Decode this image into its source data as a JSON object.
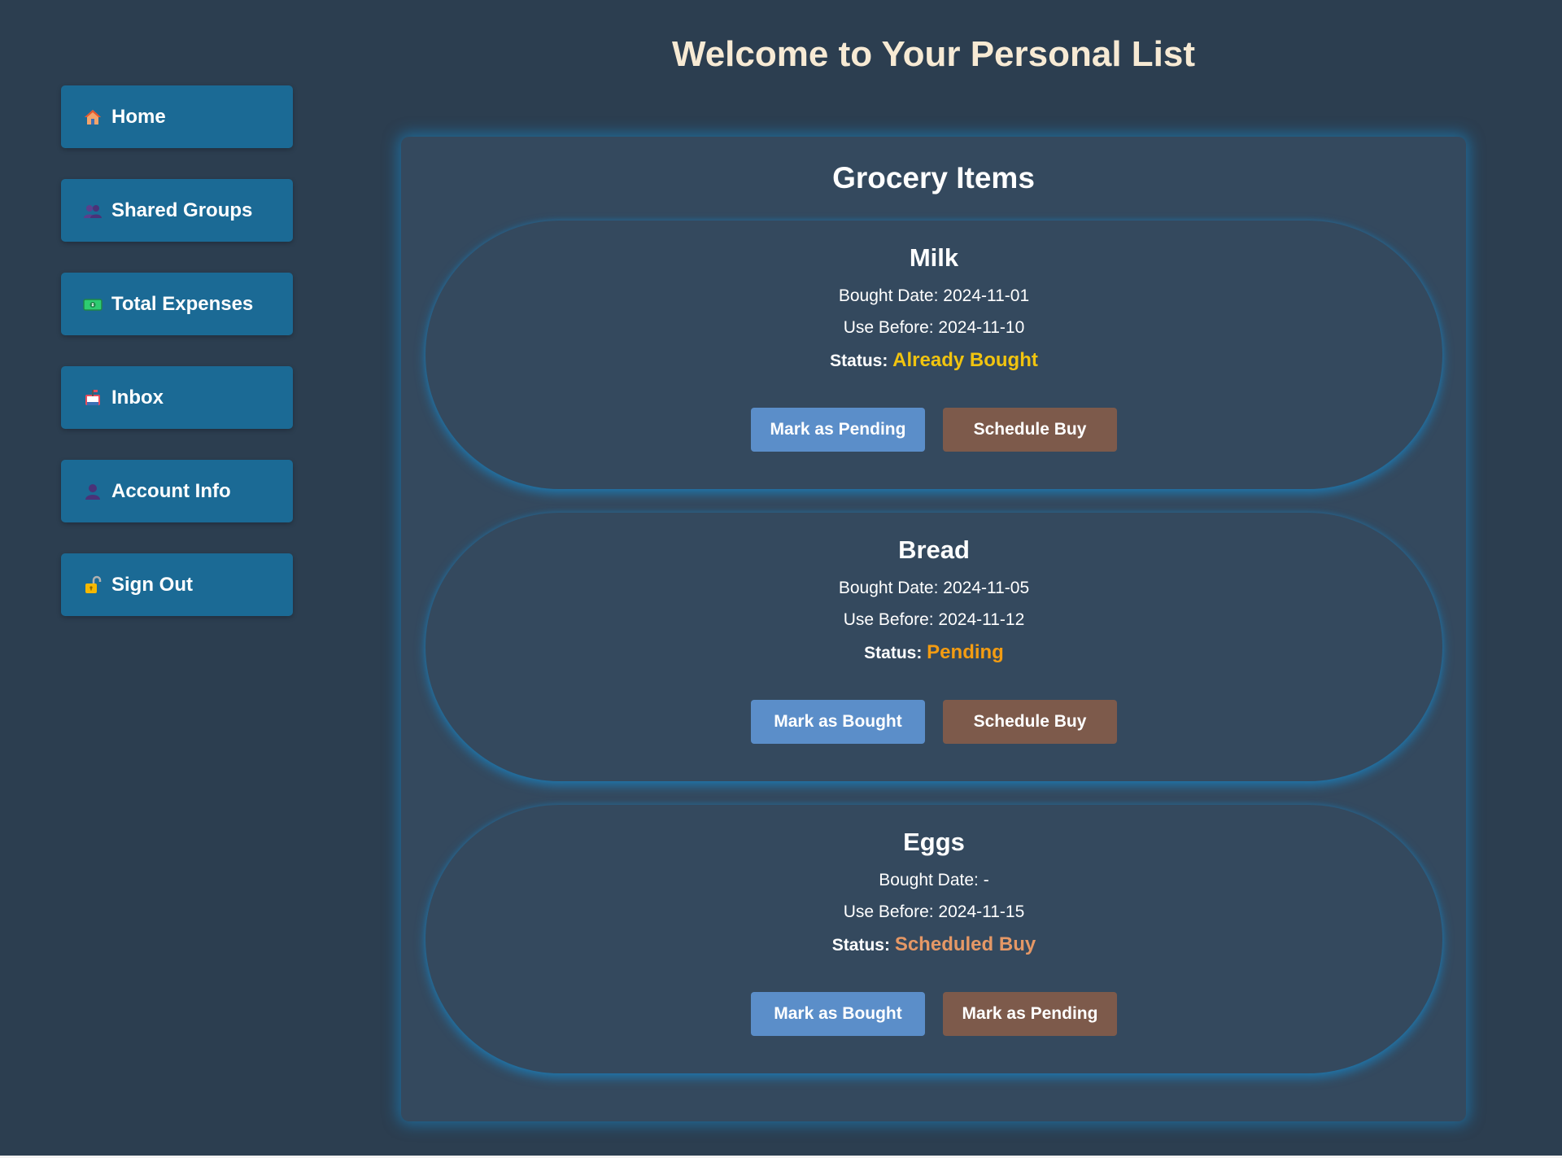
{
  "header": {
    "title": "Welcome to Your Personal List"
  },
  "sidebar": {
    "items": [
      {
        "label": "Home",
        "icon": "house-icon"
      },
      {
        "label": "Shared Groups",
        "icon": "people-icon"
      },
      {
        "label": "Total Expenses",
        "icon": "money-icon"
      },
      {
        "label": "Inbox",
        "icon": "inbox-icon"
      },
      {
        "label": "Account Info",
        "icon": "user-icon"
      },
      {
        "label": "Sign Out",
        "icon": "unlock-icon"
      }
    ]
  },
  "main": {
    "section_title": "Grocery Items",
    "items": [
      {
        "name": "Milk",
        "bought": "Bought Date: 2024-11-01",
        "use_before": "Use Before: 2024-11-10",
        "status_label": "Status:",
        "status_value": "Already Bought",
        "status_color": "#f1c40f",
        "btn_primary": "Mark as Pending",
        "btn_secondary": "Schedule Buy"
      },
      {
        "name": "Bread",
        "bought": "Bought Date: 2024-11-05",
        "use_before": "Use Before: 2024-11-12",
        "status_label": "Status:",
        "status_value": "Pending",
        "status_color": "#f39c12",
        "btn_primary": "Mark as Bought",
        "btn_secondary": "Schedule Buy"
      },
      {
        "name": "Eggs",
        "bought": "Bought Date: -",
        "use_before": "Use Before: 2024-11-15",
        "status_label": "Status:",
        "status_value": "Scheduled Buy",
        "status_color": "#e59866",
        "btn_primary": "Mark as Bought",
        "btn_secondary": "Mark as Pending"
      }
    ]
  },
  "colors": {
    "background": "#2c3e50",
    "panel": "#34495e",
    "nav_button": "#1b6a95",
    "title": "#f7ead4",
    "glow": "#158fd6",
    "button_primary": "#5b8ec9",
    "button_secondary": "#7d5a4b"
  }
}
